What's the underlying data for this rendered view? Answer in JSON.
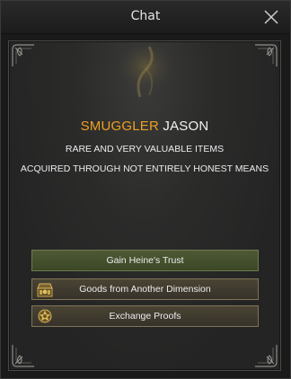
{
  "window": {
    "title": "Chat"
  },
  "npc": {
    "title": "SMUGGLER",
    "name": "JASON",
    "description": [
      "RARE AND VERY VALUABLE ITEMS",
      "ACQUIRED THROUGH NOT ENTIRELY HONEST MEANS"
    ]
  },
  "options": [
    {
      "label": "Gain Heine's Trust",
      "icon": "none"
    },
    {
      "label": "Goods from Another Dimension",
      "icon": "merchant-shop-icon"
    },
    {
      "label": "Exchange Proofs",
      "icon": "exchange-emblem-icon"
    }
  ],
  "colors": {
    "npc_title": "#f0a020",
    "npc_name": "#f2f2f2",
    "trust_button": "#4d5a34",
    "option_button": "#4a4434"
  }
}
